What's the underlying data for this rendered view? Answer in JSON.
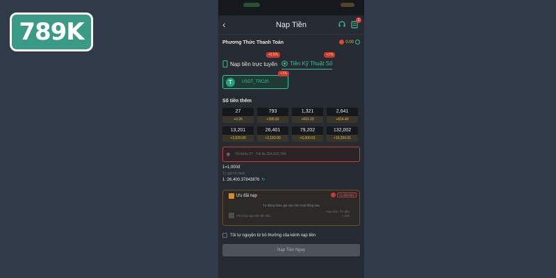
{
  "brand": {
    "logo_text": "789K"
  },
  "header": {
    "title": "Nạp Tiền",
    "back_icon": "chevron-left-icon",
    "badge_count": "1"
  },
  "payment": {
    "section_title": "Phương Thức Thanh Toán",
    "balance": "0.00",
    "tabs": [
      {
        "label": "Nạp tiền trực tuyến",
        "promo": "+0.5%",
        "active": false
      },
      {
        "label": "Tiền Kỹ Thuật Số",
        "promo": "+1%",
        "active": true
      }
    ],
    "method": {
      "label": "USDT_TRC20",
      "promo": "+1%",
      "icon": "tether-icon"
    }
  },
  "amounts": {
    "title": "Số tiền thêm",
    "items": [
      {
        "value": "27",
        "bonus": "+0.26"
      },
      {
        "value": "793",
        "bonus": "+395.92"
      },
      {
        "value": "1,321",
        "bonus": "+601.20"
      },
      {
        "value": "2,641",
        "bonus": "+814.40"
      },
      {
        "value": "13,201",
        "bonus": "+2,020.00"
      },
      {
        "value": "26,401",
        "bonus": "+2,152.00"
      },
      {
        "value": "79,202",
        "bonus": "+6,600.01"
      },
      {
        "value": "132,002",
        "bonus": "+10,200.01"
      }
    ]
  },
  "input": {
    "placeholder": "Tối thiểu 27 - Tối đa 264,003,784"
  },
  "rate": {
    "ratio": "1=1,000đ",
    "hint": "Tỷ giá hối đoái",
    "value": "1 :26,400.37843876"
  },
  "bonus": {
    "title": "Ưu đãi nạp",
    "tag": "+2,025.0001",
    "note": "Tự động tham gia vào các hoạt động sau",
    "first_deposit": "Thưởng nạp tiền lần đầu",
    "limit_label": "Nạp tiền: Ẩn dấu",
    "limit_value": "+ 100"
  },
  "agree": {
    "label": "Tôi tự nguyện từ bỏ thưởng của kênh nạp tiền"
  },
  "submit": {
    "label": "Nạp Tiền Ngay"
  },
  "colors": {
    "accent": "#3ac49a",
    "background": "#303a48",
    "panel": "#262b31",
    "error": "#c9403c"
  }
}
